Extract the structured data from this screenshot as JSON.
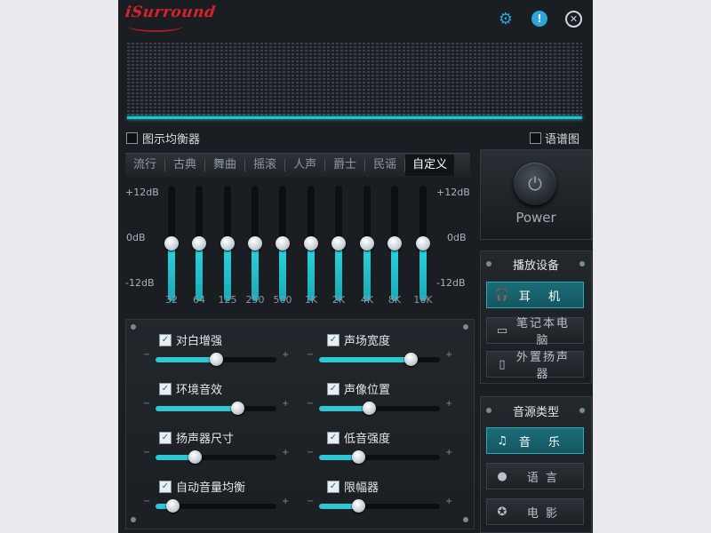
{
  "app": {
    "logo": "iSurround"
  },
  "header": {
    "settings_icon": "gear-icon",
    "info_icon": "info-icon",
    "close_icon": "close-icon",
    "info_glyph": "!",
    "close_glyph": "✕"
  },
  "toggles": {
    "graphic_eq_label": "图示均衡器",
    "spectrum_label": "语谱图",
    "graphic_eq_checked": false,
    "spectrum_checked": false
  },
  "presets": [
    "流行",
    "古典",
    "舞曲",
    "摇滚",
    "人声",
    "爵士",
    "民谣",
    "自定义"
  ],
  "active_preset": "自定义",
  "eq": {
    "db_top": "+12dB",
    "db_mid": "0dB",
    "db_bottom": "-12dB",
    "bands": [
      {
        "label": "32",
        "gain_db": 0
      },
      {
        "label": "64",
        "gain_db": 0
      },
      {
        "label": "125",
        "gain_db": 0
      },
      {
        "label": "250",
        "gain_db": 0
      },
      {
        "label": "500",
        "gain_db": 0
      },
      {
        "label": "1K",
        "gain_db": 0
      },
      {
        "label": "2K",
        "gain_db": 0
      },
      {
        "label": "4K",
        "gain_db": 0
      },
      {
        "label": "8K",
        "gain_db": 0
      },
      {
        "label": "16K",
        "gain_db": 0
      }
    ]
  },
  "power": {
    "label": "Power",
    "icon": "power-icon",
    "glyph": "⏻"
  },
  "playback": {
    "title": "播放设备",
    "items": [
      {
        "label": "耳 机",
        "icon": "headphones-icon",
        "glyph": "🎧",
        "active": true
      },
      {
        "label": "笔记本电脑",
        "icon": "laptop-icon",
        "glyph": "▭",
        "active": false
      },
      {
        "label": "外置扬声器",
        "icon": "speaker-icon",
        "glyph": "▯",
        "active": false
      }
    ]
  },
  "source": {
    "title": "音源类型",
    "items": [
      {
        "label": "音 乐",
        "icon": "music-note-icon",
        "glyph": "♫",
        "active": true
      },
      {
        "label": "语 言",
        "icon": "speech-bubble-icon",
        "glyph": "●",
        "active": false
      },
      {
        "label": "电 影",
        "icon": "film-reel-icon",
        "glyph": "✪",
        "active": false
      }
    ]
  },
  "effects": {
    "minus": "−",
    "plus": "+",
    "items": [
      {
        "label": "对白增强",
        "checked": true,
        "value": 0.5
      },
      {
        "label": "声场宽度",
        "checked": true,
        "value": 0.76
      },
      {
        "label": "环境音效",
        "checked": true,
        "value": 0.68
      },
      {
        "label": "声像位置",
        "checked": true,
        "value": 0.41
      },
      {
        "label": "扬声器尺寸",
        "checked": true,
        "value": 0.32
      },
      {
        "label": "低音强度",
        "checked": true,
        "value": 0.32
      },
      {
        "label": "自动音量均衡",
        "checked": true,
        "value": 0.14
      },
      {
        "label": "限幅器",
        "checked": true,
        "value": 0.32
      }
    ]
  },
  "colors": {
    "accent": "#2ec8d4",
    "logo": "#d8232a",
    "background": "#1a1e22"
  }
}
